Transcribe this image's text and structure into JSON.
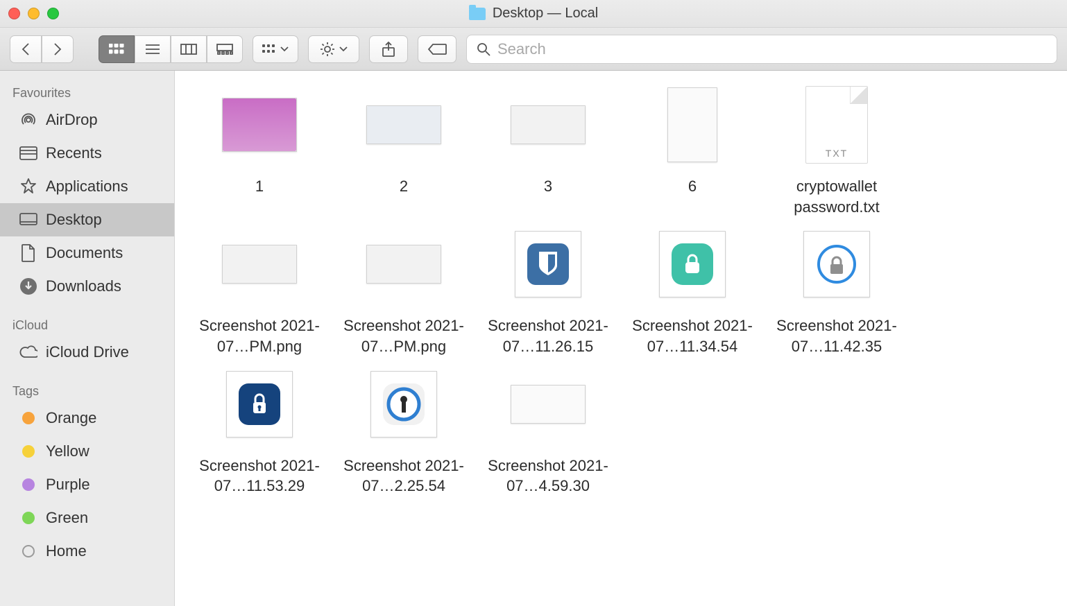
{
  "window": {
    "title": "Desktop — Local"
  },
  "search": {
    "placeholder": "Search"
  },
  "sidebar": {
    "sections": [
      {
        "heading": "Favourites",
        "items": [
          {
            "icon": "airdrop",
            "label": "AirDrop",
            "selected": false
          },
          {
            "icon": "recents",
            "label": "Recents",
            "selected": false
          },
          {
            "icon": "apps",
            "label": "Applications",
            "selected": false
          },
          {
            "icon": "desktop",
            "label": "Desktop",
            "selected": true
          },
          {
            "icon": "documents",
            "label": "Documents",
            "selected": false
          },
          {
            "icon": "downloads",
            "label": "Downloads",
            "selected": false
          }
        ]
      },
      {
        "heading": "iCloud",
        "items": [
          {
            "icon": "cloud",
            "label": "iCloud Drive",
            "selected": false
          }
        ]
      },
      {
        "heading": "Tags",
        "items": [
          {
            "icon": "tag",
            "color": "orange",
            "label": "Orange"
          },
          {
            "icon": "tag",
            "color": "yellow",
            "label": "Yellow"
          },
          {
            "icon": "tag",
            "color": "purple",
            "label": "Purple"
          },
          {
            "icon": "tag",
            "color": "green",
            "label": "Green"
          },
          {
            "icon": "tag",
            "color": "gray",
            "label": "Home"
          }
        ]
      }
    ]
  },
  "files": [
    {
      "name": "1",
      "thumb": "wide",
      "mini": "a"
    },
    {
      "name": "2",
      "thumb": "shot",
      "mini": "b"
    },
    {
      "name": "3",
      "thumb": "shot",
      "mini": "c"
    },
    {
      "name": "6",
      "thumb": "tall",
      "mini": "d"
    },
    {
      "name": "cryptowallet password.txt",
      "thumb": "txt"
    },
    {
      "name": "",
      "thumb": "none"
    },
    {
      "name": "Screenshot 2021-07…PM.png",
      "thumb": "shot",
      "mini": "c"
    },
    {
      "name": "Screenshot 2021-07…PM.png",
      "thumb": "shot",
      "mini": "c"
    },
    {
      "name": "Screenshot 2021-07…11.26.15",
      "thumb": "square",
      "app": "bitwarden"
    },
    {
      "name": "Screenshot 2021-07…11.34.54",
      "thumb": "square",
      "app": "teal-lock"
    },
    {
      "name": "Screenshot 2021-07…11.42.35",
      "thumb": "square",
      "app": "blue-lock"
    },
    {
      "name": "",
      "thumb": "none"
    },
    {
      "name": "Screenshot 2021-07…11.53.29",
      "thumb": "square",
      "app": "enpass"
    },
    {
      "name": "Screenshot 2021-07…2.25.54",
      "thumb": "square",
      "app": "onepass"
    },
    {
      "name": "Screenshot 2021-07…4.59.30",
      "thumb": "shot",
      "mini": "d"
    }
  ]
}
